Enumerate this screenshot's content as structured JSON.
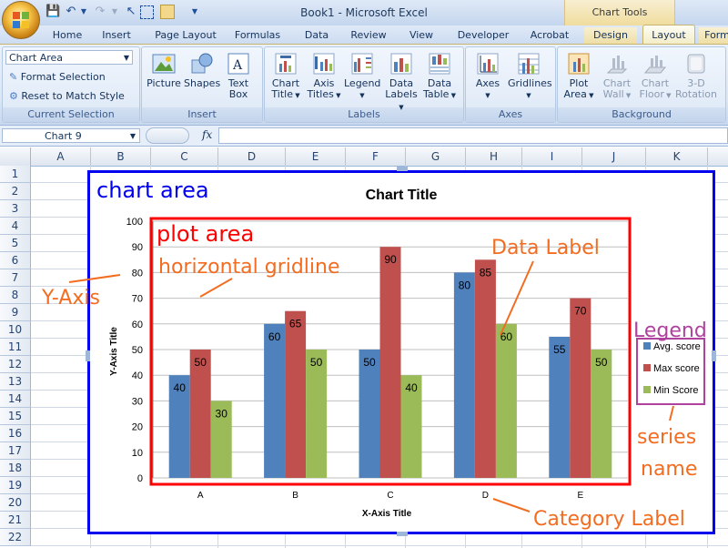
{
  "window": {
    "title": "Book1 - Microsoft Excel",
    "context_tab_group": "Chart Tools"
  },
  "tabs": [
    "Home",
    "Insert",
    "Page Layout",
    "Formulas",
    "Data",
    "Review",
    "View",
    "Developer",
    "Acrobat",
    "Design",
    "Layout",
    "Form"
  ],
  "active_tab": "Layout",
  "ribbon": {
    "current_selection": {
      "dropdown": "Chart Area",
      "format_selection": "Format Selection",
      "reset": "Reset to Match Style",
      "label": "Current Selection"
    },
    "insert": {
      "label": "Insert",
      "picture": "Picture",
      "shapes": "Shapes",
      "text_box_1": "Text",
      "text_box_2": "Box"
    },
    "labels": {
      "label": "Labels",
      "chart_title_1": "Chart",
      "chart_title_2": "Title",
      "axis_titles_1": "Axis",
      "axis_titles_2": "Titles",
      "legend": "Legend",
      "data_labels_1": "Data",
      "data_labels_2": "Labels",
      "data_table_1": "Data",
      "data_table_2": "Table"
    },
    "axes": {
      "label": "Axes",
      "axes": "Axes",
      "gridlines": "Gridlines"
    },
    "background": {
      "label": "Background",
      "plot_area_1": "Plot",
      "plot_area_2": "Area",
      "chart_wall_1": "Chart",
      "chart_wall_2": "Wall",
      "chart_floor_1": "Chart",
      "chart_floor_2": "Floor",
      "rotation_1": "3-D",
      "rotation_2": "Rotation"
    }
  },
  "formula_bar": {
    "name_box": "Chart 9",
    "fx": "fx",
    "value": ""
  },
  "columns": [
    "A",
    "B",
    "C",
    "D",
    "E",
    "F",
    "G",
    "H",
    "I",
    "J",
    "K"
  ],
  "rows": [
    "1",
    "2",
    "3",
    "4",
    "5",
    "6",
    "7",
    "8",
    "9",
    "10",
    "11",
    "12",
    "13",
    "14",
    "15",
    "16",
    "17",
    "18",
    "19",
    "20",
    "21",
    "22"
  ],
  "chart_data": {
    "type": "bar",
    "title": "Chart Title",
    "xlabel": "X-Axis Title",
    "ylabel": "Y-Axis Title",
    "categories": [
      "A",
      "B",
      "C",
      "D",
      "E"
    ],
    "series": [
      {
        "name": "Avg. score",
        "color": "#4f81bd",
        "values": [
          40,
          60,
          50,
          80,
          55
        ]
      },
      {
        "name": "Max score",
        "color": "#c0504d",
        "values": [
          50,
          65,
          90,
          85,
          70
        ]
      },
      {
        "name": "Min Score",
        "color": "#9bbb59",
        "values": [
          30,
          50,
          40,
          60,
          50
        ]
      }
    ],
    "ylim": [
      0,
      100
    ],
    "yticks": [
      0,
      10,
      20,
      30,
      40,
      50,
      60,
      70,
      80,
      90,
      100
    ],
    "grid": true,
    "legend": "right",
    "data_labels": true
  },
  "annotations": {
    "chart_area": "chart area",
    "plot_area": "plot area",
    "horizontal_gridline": "horizontal gridline",
    "y_axis": "Y-Axis",
    "data_label": "Data Label",
    "legend": "Legend",
    "series_name_1": "series",
    "series_name_2": "name",
    "category_label": "Category Label",
    "colors": {
      "chart_area": "#0000ee",
      "plot_area": "#ff0000",
      "callout": "#f26d21",
      "legend": "#b0419e"
    }
  }
}
